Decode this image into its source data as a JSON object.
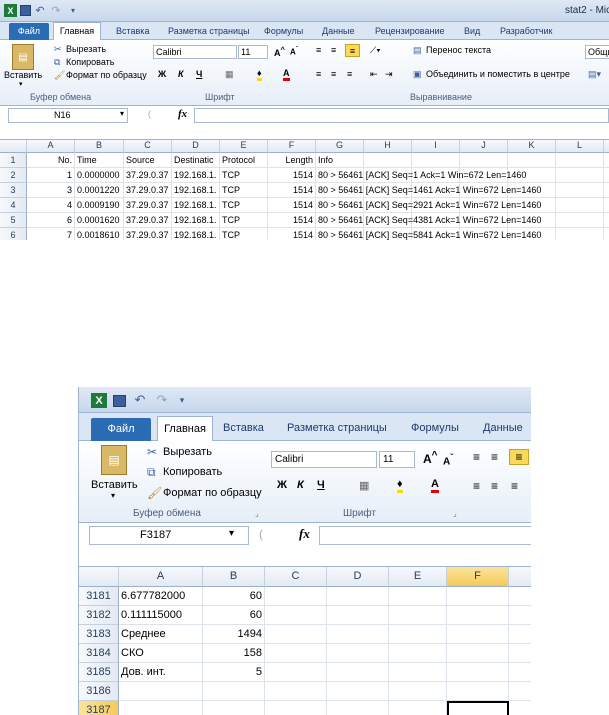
{
  "top": {
    "title": "stat2 - Mic",
    "tabs": {
      "file": "Файл",
      "home": "Главная",
      "insert": "Вставка",
      "layout": "Разметка страницы",
      "formulas": "Формулы",
      "data": "Данные",
      "review": "Рецензирование",
      "view": "Вид",
      "dev": "Разработчик"
    },
    "ribbon": {
      "paste": "Вставить",
      "cut": "Вырезать",
      "copy": "Копировать",
      "format_painter": "Формат по образцу",
      "clipboard": "Буфер обмена",
      "font_name": "Calibri",
      "font_size": "11",
      "font_group": "Шрифт",
      "wrap": "Перенос текста",
      "merge": "Объединить и поместить в центре",
      "align_group": "Выравнивание",
      "number_format": "Общи"
    },
    "namebox": "N16",
    "fx": "fx",
    "columns": [
      "A",
      "B",
      "C",
      "D",
      "E",
      "F",
      "G",
      "H",
      "I",
      "J",
      "K",
      "L"
    ],
    "rows": [
      {
        "n": "1",
        "A": "No.",
        "B": "Time",
        "C": "Source",
        "D": "Destinatic",
        "E": "Protocol",
        "F": "Length",
        "G": "Info"
      },
      {
        "n": "2",
        "A": "1",
        "B": "0.0000000",
        "C": "37.29.0.37",
        "D": "192.168.1.",
        "E": "TCP",
        "F": "1514",
        "G": "80 > 56461 [ACK] Seq=1 Ack=1 Win=672 Len=1460"
      },
      {
        "n": "3",
        "A": "3",
        "B": "0.0001220",
        "C": "37.29.0.37",
        "D": "192.168.1.",
        "E": "TCP",
        "F": "1514",
        "G": "80 > 56461 [ACK] Seq=1461 Ack=1 Win=672 Len=1460"
      },
      {
        "n": "4",
        "A": "4",
        "B": "0.0009190",
        "C": "37.29.0.37",
        "D": "192.168.1.",
        "E": "TCP",
        "F": "1514",
        "G": "80 > 56461 [ACK] Seq=2921 Ack=1 Win=672 Len=1460"
      },
      {
        "n": "5",
        "A": "6",
        "B": "0.0001620",
        "C": "37.29.0.37",
        "D": "192.168.1.",
        "E": "TCP",
        "F": "1514",
        "G": "80 > 56461 [ACK] Seq=4381 Ack=1 Win=672 Len=1460"
      },
      {
        "n": "6",
        "A": "7",
        "B": "0.0018610",
        "C": "37.29.0.37",
        "D": "192.168.1.",
        "E": "TCP",
        "F": "1514",
        "G": "80 > 56461 [ACK] Seq=5841 Ack=1 Win=672 Len=1460"
      }
    ]
  },
  "bottom": {
    "tabs": {
      "file": "Файл",
      "home": "Главная",
      "insert": "Вставка",
      "layout": "Разметка страницы",
      "formulas": "Формулы",
      "data": "Данные"
    },
    "ribbon": {
      "paste": "Вставить",
      "cut": "Вырезать",
      "copy": "Копировать",
      "format_painter": "Формат по образцу",
      "clipboard": "Буфер обмена",
      "font_name": "Calibri",
      "font_size": "11",
      "font_group": "Шрифт"
    },
    "namebox": "F3187",
    "fx": "fx",
    "columns": [
      "A",
      "B",
      "C",
      "D",
      "E",
      "F"
    ],
    "rows": [
      {
        "n": "3181",
        "A": "6.677782000",
        "B": "60"
      },
      {
        "n": "3182",
        "A": "0.111115000",
        "B": "60"
      },
      {
        "n": "3183",
        "A": "Среднее",
        "B": "1494"
      },
      {
        "n": "3184",
        "A": "СКО",
        "B": "158"
      },
      {
        "n": "3185",
        "A": "Дов. инт.",
        "B": "5"
      },
      {
        "n": "3186",
        "A": "",
        "B": ""
      },
      {
        "n": "3187",
        "A": "",
        "B": ""
      }
    ]
  }
}
